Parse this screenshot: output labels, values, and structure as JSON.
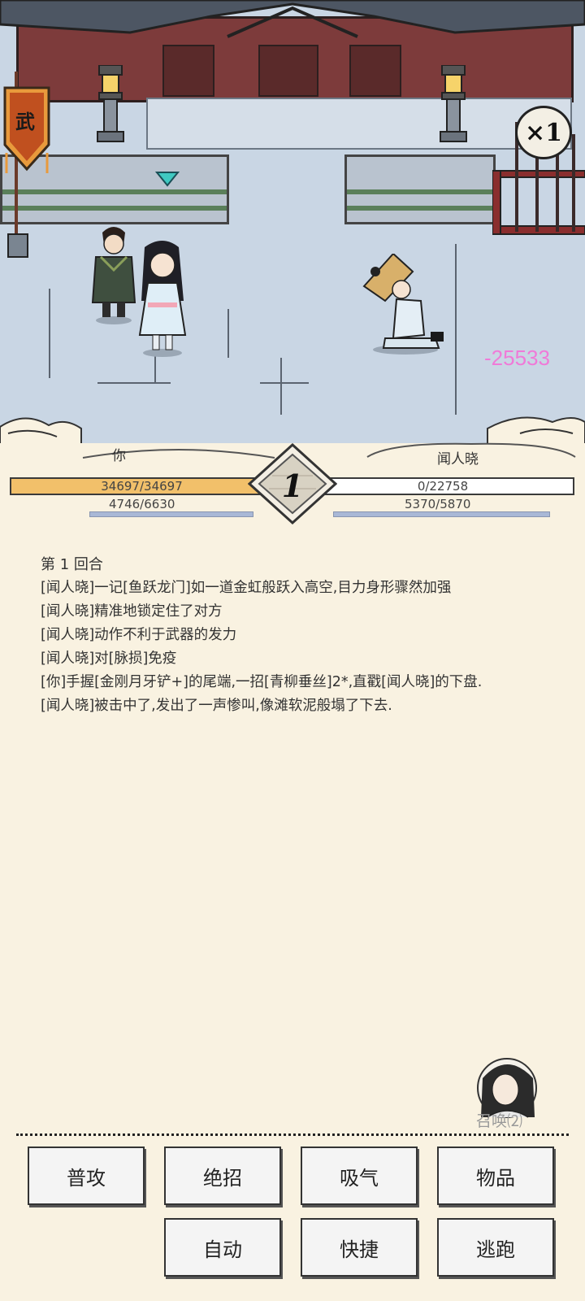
{
  "scene": {
    "banner_char": "武",
    "speed_label": "×1",
    "damage_text": "-25533",
    "colors": {
      "damage": "#f07ad8",
      "hp_fill": "#f2c06a",
      "background": "#f9f2e1"
    }
  },
  "status": {
    "player_name": "你",
    "enemy_name": "闻人晓",
    "round_number": "1",
    "player_hp": "34697/34697",
    "player_hp_fraction": 1.0,
    "player_mp": "4746/6630",
    "enemy_hp": "0/22758",
    "enemy_hp_fraction": 0.0,
    "enemy_mp": "5370/5870"
  },
  "log": {
    "title": "第 1 回合",
    "lines": [
      "[闻人晓]一记[鱼跃龙门]如一道金虹般跃入高空,目力身形骤然加强",
      "[闻人晓]精准地锁定住了对方",
      "[闻人晓]动作不利于武器的发力",
      "[闻人晓]对[脉损]免疫",
      "[你]手握[金刚月牙铲+]的尾端,一招[青柳垂丝]2*,直戳[闻人晓]的下盘.",
      "[闻人晓]被击中了,发出了一声惨叫,像滩软泥般塌了下去."
    ]
  },
  "summon": {
    "label": "召唤⑵"
  },
  "actions": {
    "attack": "普攻",
    "ultimate": "绝招",
    "breathe": "吸气",
    "items": "物品",
    "auto": "自动",
    "quick": "快捷",
    "flee": "逃跑"
  }
}
